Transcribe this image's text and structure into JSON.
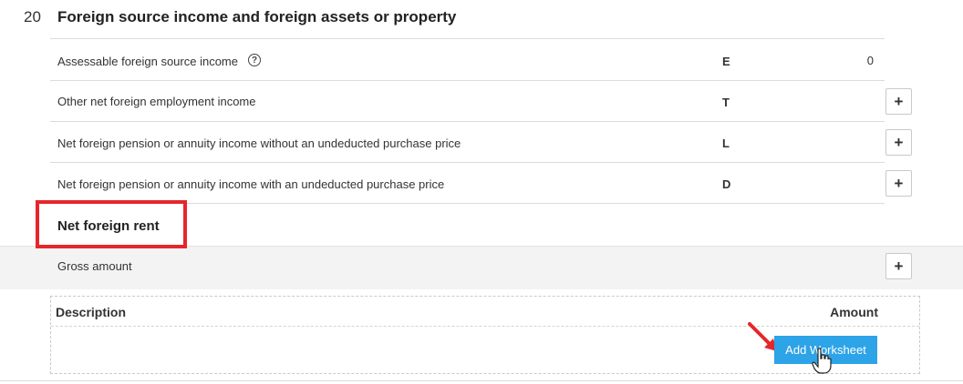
{
  "section": {
    "number": "20",
    "title": "Foreign source income and foreign assets or property"
  },
  "rows": [
    {
      "label": "Assessable foreign source income",
      "code": "E",
      "value": "0"
    },
    {
      "label": "Other net foreign employment income",
      "code": "T",
      "value": ""
    },
    {
      "label": "Net foreign pension or annuity income without an undeducted purchase price",
      "code": "L",
      "value": ""
    },
    {
      "label": "Net foreign pension or annuity income with an undeducted purchase price",
      "code": "D",
      "value": ""
    }
  ],
  "help_icon_glyph": "?",
  "plus_label": "+",
  "subsection": {
    "title": "Net foreign rent",
    "gross_label": "Gross amount"
  },
  "worksheet": {
    "description_header": "Description",
    "amount_header": "Amount",
    "add_button_label": "Add Worksheet"
  },
  "colors": {
    "highlight": "#e5262b",
    "button_blue": "#2da3e8",
    "arrow": "#e5262b"
  }
}
